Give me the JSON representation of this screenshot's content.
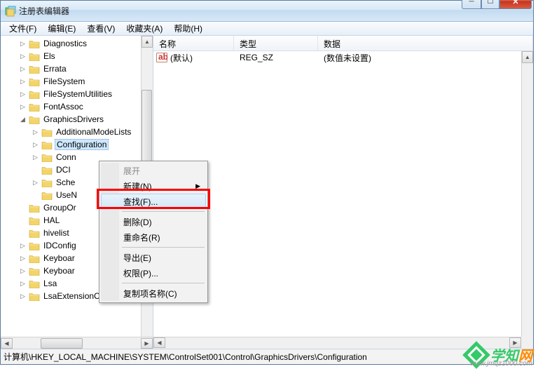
{
  "window": {
    "title": "注册表编辑器"
  },
  "menu": {
    "file": "文件(F)",
    "edit": "编辑(E)",
    "view": "查看(V)",
    "favorites": "收藏夹(A)",
    "help": "帮助(H)"
  },
  "tree": {
    "items": [
      {
        "label": "Diagnostics",
        "level": 1,
        "exp": "▷"
      },
      {
        "label": "Els",
        "level": 1,
        "exp": "▷"
      },
      {
        "label": "Errata",
        "level": 1,
        "exp": "▷"
      },
      {
        "label": "FileSystem",
        "level": 1,
        "exp": "▷"
      },
      {
        "label": "FileSystemUtilities",
        "level": 1,
        "exp": "▷"
      },
      {
        "label": "FontAssoc",
        "level": 1,
        "exp": "▷"
      },
      {
        "label": "GraphicsDrivers",
        "level": 1,
        "exp": "◢"
      },
      {
        "label": "AdditionalModeLists",
        "level": 2,
        "exp": "▷"
      },
      {
        "label": "Configuration",
        "level": 2,
        "exp": "▷",
        "selected": true
      },
      {
        "label": "Conn",
        "level": 2,
        "exp": "▷"
      },
      {
        "label": "DCI",
        "level": 2,
        "exp": ""
      },
      {
        "label": "Sche",
        "level": 2,
        "exp": "▷"
      },
      {
        "label": "UseN",
        "level": 2,
        "exp": ""
      },
      {
        "label": "GroupOr",
        "level": 1,
        "exp": ""
      },
      {
        "label": "HAL",
        "level": 1,
        "exp": ""
      },
      {
        "label": "hivelist",
        "level": 1,
        "exp": ""
      },
      {
        "label": "IDConfig",
        "level": 1,
        "exp": "▷"
      },
      {
        "label": "Keyboar",
        "level": 1,
        "exp": "▷"
      },
      {
        "label": "Keyboar",
        "level": 1,
        "exp": "▷"
      },
      {
        "label": "Lsa",
        "level": 1,
        "exp": "▷"
      },
      {
        "label": "LsaExtensionConfig",
        "level": 1,
        "exp": "▷"
      }
    ]
  },
  "list": {
    "cols": {
      "name": "名称",
      "type": "类型",
      "data": "数据"
    },
    "rows": [
      {
        "name": "(默认)",
        "type": "REG_SZ",
        "data": "(数值未设置)"
      }
    ]
  },
  "context": {
    "expand": "展开",
    "new": "新建(N)",
    "find": "查找(F)...",
    "delete": "删除(D)",
    "rename": "重命名(R)",
    "export": "导出(E)",
    "permissions": "权限(P)...",
    "copykey": "复制项名称(C)"
  },
  "status": {
    "path": "计算机\\HKEY_LOCAL_MACHINE\\SYSTEM\\ControlSet001\\Control\\GraphicsDrivers\\Configuration"
  },
  "watermark": {
    "t1": "学知",
    "t2": "网",
    "url": "www.jmqz1000.com"
  }
}
